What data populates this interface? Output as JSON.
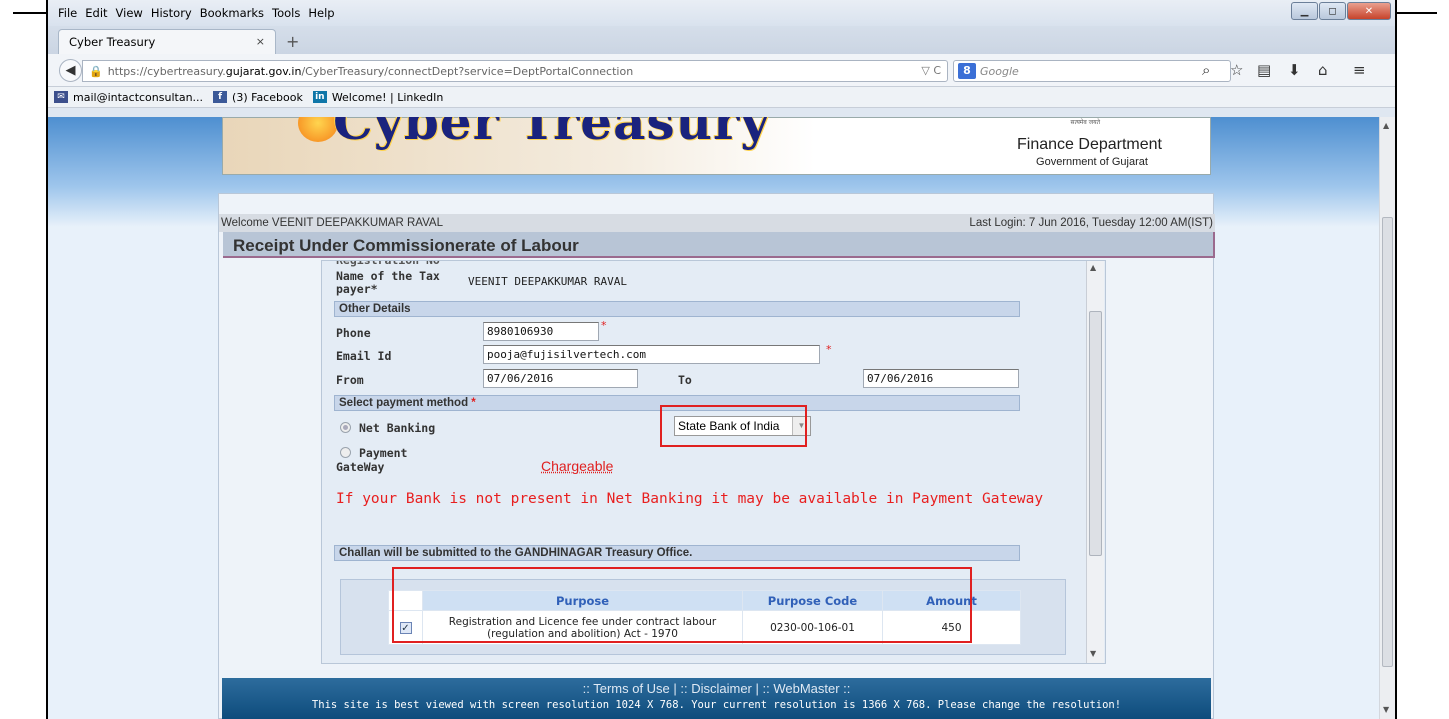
{
  "menubar": {
    "items": [
      "File",
      "Edit",
      "View",
      "History",
      "Bookmarks",
      "Tools",
      "Help"
    ],
    "underline": [
      "F",
      "E",
      "V",
      "s",
      "B",
      "T",
      "H"
    ]
  },
  "tab": {
    "title": "Cyber Treasury",
    "close": "×",
    "new_tab": "+"
  },
  "nav": {
    "url_prefix": "https://cybertreasury.",
    "url_domain": "gujarat.gov.in",
    "url_suffix": "/CyberTreasury/connectDept?service=DeptPortalConnection",
    "url_right": "▽ C",
    "search_placeholder": "Google",
    "search_engine": "8"
  },
  "bookmarks": [
    {
      "icon": "mail-icon",
      "label": "mail@intactconsultan..."
    },
    {
      "icon": "facebook-icon",
      "label": "(3) Facebook"
    },
    {
      "icon": "linkedin-icon",
      "label": "Welcome! | LinkedIn"
    }
  ],
  "banner": {
    "title": "Cyber Treasury",
    "department": "Finance Department",
    "government": "Government of Gujarat",
    "emblem_text": "सत्यमेव जयते"
  },
  "welcome": {
    "user": "Welcome VEENIT DEEPAKKUMAR RAVAL",
    "last_login": "Last Login: 7 Jun 2016, Tuesday 12:00 AM(IST)"
  },
  "page_title": "Receipt Under Commissionerate of Labour",
  "form": {
    "taxpayer_label": "Name of the Tax payer*",
    "taxpayer_label_line1": "Name of the Tax",
    "taxpayer_label_line2": "payer*",
    "taxpayer_value": "VEENIT DEEPAKKUMAR RAVAL",
    "other_details": "Other Details",
    "phone_label": "Phone",
    "phone_value": "8980106930",
    "email_label": "Email Id",
    "email_value": "pooja@fujisilvertech.com",
    "from_label": "From",
    "from_value": "07/06/2016",
    "to_label": "To",
    "to_value": "07/06/2016",
    "payment_method": "Select payment method",
    "required_mark": "*",
    "net_banking": "Net Banking",
    "payment_gateway_line1": "Payment",
    "payment_gateway_line2": "GateWay",
    "bank_selected": "State Bank of India",
    "chargeable": "Chargeable",
    "bank_note": "If your Bank is not present in Net Banking it may be available in Payment Gateway",
    "challan_note": "Challan will be submitted to the GANDHINAGAR Treasury Office."
  },
  "table": {
    "headers": [
      "",
      "Purpose",
      "Purpose Code",
      "Amount"
    ],
    "rows": [
      {
        "checked": true,
        "purpose_line1": "Registration and Licence fee under contract labour",
        "purpose_line2": "(regulation and abolition) Act - 1970",
        "code": "0230-00-106-01",
        "amount": "450"
      }
    ]
  },
  "footer": {
    "links": ":: Terms of Use | :: Disclaimer | :: WebMaster ::",
    "note": "This site is best viewed with screen resolution 1024 X 768. Your current resolution is 1366 X 768. Please change the resolution!"
  },
  "colors": {
    "accent_red": "#e02020",
    "header_blue": "#3060b8",
    "footer_blue": "#0e4c7c"
  }
}
